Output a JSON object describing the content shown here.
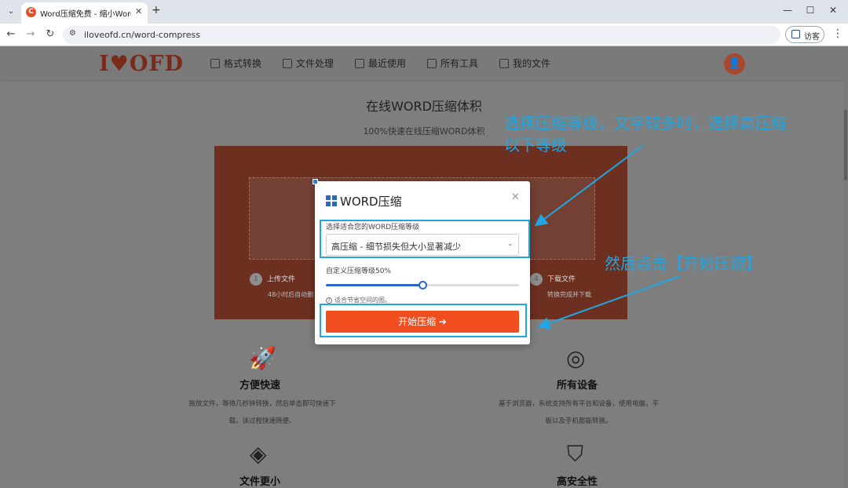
{
  "browser": {
    "tab_title": "Word压缩免费 - 缩小Word体积",
    "favicon_letter": "C",
    "url": "iloveofd.cn/word-compress",
    "guest_label": "访客"
  },
  "header": {
    "logo": "I♥OFD",
    "nav": [
      "格式转换",
      "文件处理",
      "最近使用",
      "所有工具",
      "我的文件"
    ]
  },
  "hero": {
    "title": "在线WORD压缩体积",
    "subtitle": "100%快速在线压缩WORD体积"
  },
  "steps": {
    "upload_label": "上传文件",
    "upload_desc": "48小时后自动删",
    "download_num": "4",
    "download_label": "下载文件",
    "download_desc": "转换完成并下载",
    "upload_num": "1"
  },
  "modal": {
    "title": "WORD压缩",
    "level_label": "选择适合您的WORD压缩等级",
    "level_value": "高压缩 - 细节损失但大小显著减少",
    "custom_label": "自定义压缩等级50%",
    "slider_value": 0.5,
    "hint": "适合节省空间的图。",
    "start_button": "开始压缩 ➔"
  },
  "features": [
    {
      "title": "方便快速",
      "desc_line1": "拖放文件，等待几秒钟转换，然后单击即可快速下",
      "desc_line2": "载。该过程快速随便。"
    },
    {
      "title": "所有设备",
      "desc_line1": "基于浏览器，系统支持所有平台和设备，使用电脑，平",
      "desc_line2": "板以及手机都能转换。"
    },
    {
      "title": "文件更小"
    },
    {
      "title": "高安全性"
    }
  ],
  "annotations": {
    "text1_line1": "选择压缩等级，文字较多时，选择高压缩",
    "text1_line2": "以下等级",
    "text2": "然后点击【开始压缩】",
    "color": "#1ea7e4"
  }
}
